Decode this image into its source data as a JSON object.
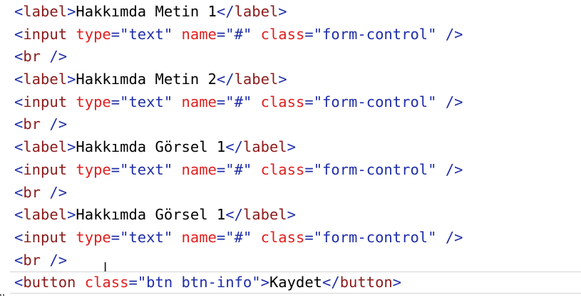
{
  "editor": {
    "lines": [
      {
        "tag": "label",
        "text": "Hakkımda Metin 1"
      },
      {
        "tag": "input",
        "type": "text",
        "name": "#",
        "class": "form-control"
      },
      {
        "tag": "br"
      },
      {
        "tag": "label",
        "text": "Hakkımda Metin 2"
      },
      {
        "tag": "input",
        "type": "text",
        "name": "#",
        "class": "form-control"
      },
      {
        "tag": "br"
      },
      {
        "tag": "label",
        "text": "Hakkımda Görsel 1"
      },
      {
        "tag": "input",
        "type": "text",
        "name": "#",
        "class": "form-control"
      },
      {
        "tag": "br"
      },
      {
        "tag": "label",
        "text": "Hakkımda Görsel 1"
      },
      {
        "tag": "input",
        "type": "text",
        "name": "#",
        "class": "form-control"
      },
      {
        "tag": "br"
      },
      {
        "tag": "button",
        "class": "btn btn-info",
        "text": "Kaydet"
      }
    ],
    "cursor_icon": "text-cursor-icon",
    "colors": {
      "punctuation": "#1f2ea8",
      "tag_name": "#8b1a1a",
      "attribute": "#e01e1e",
      "string": "#1f2ea8",
      "text": "#000000",
      "current_line_border": "#d4d4d4"
    }
  }
}
